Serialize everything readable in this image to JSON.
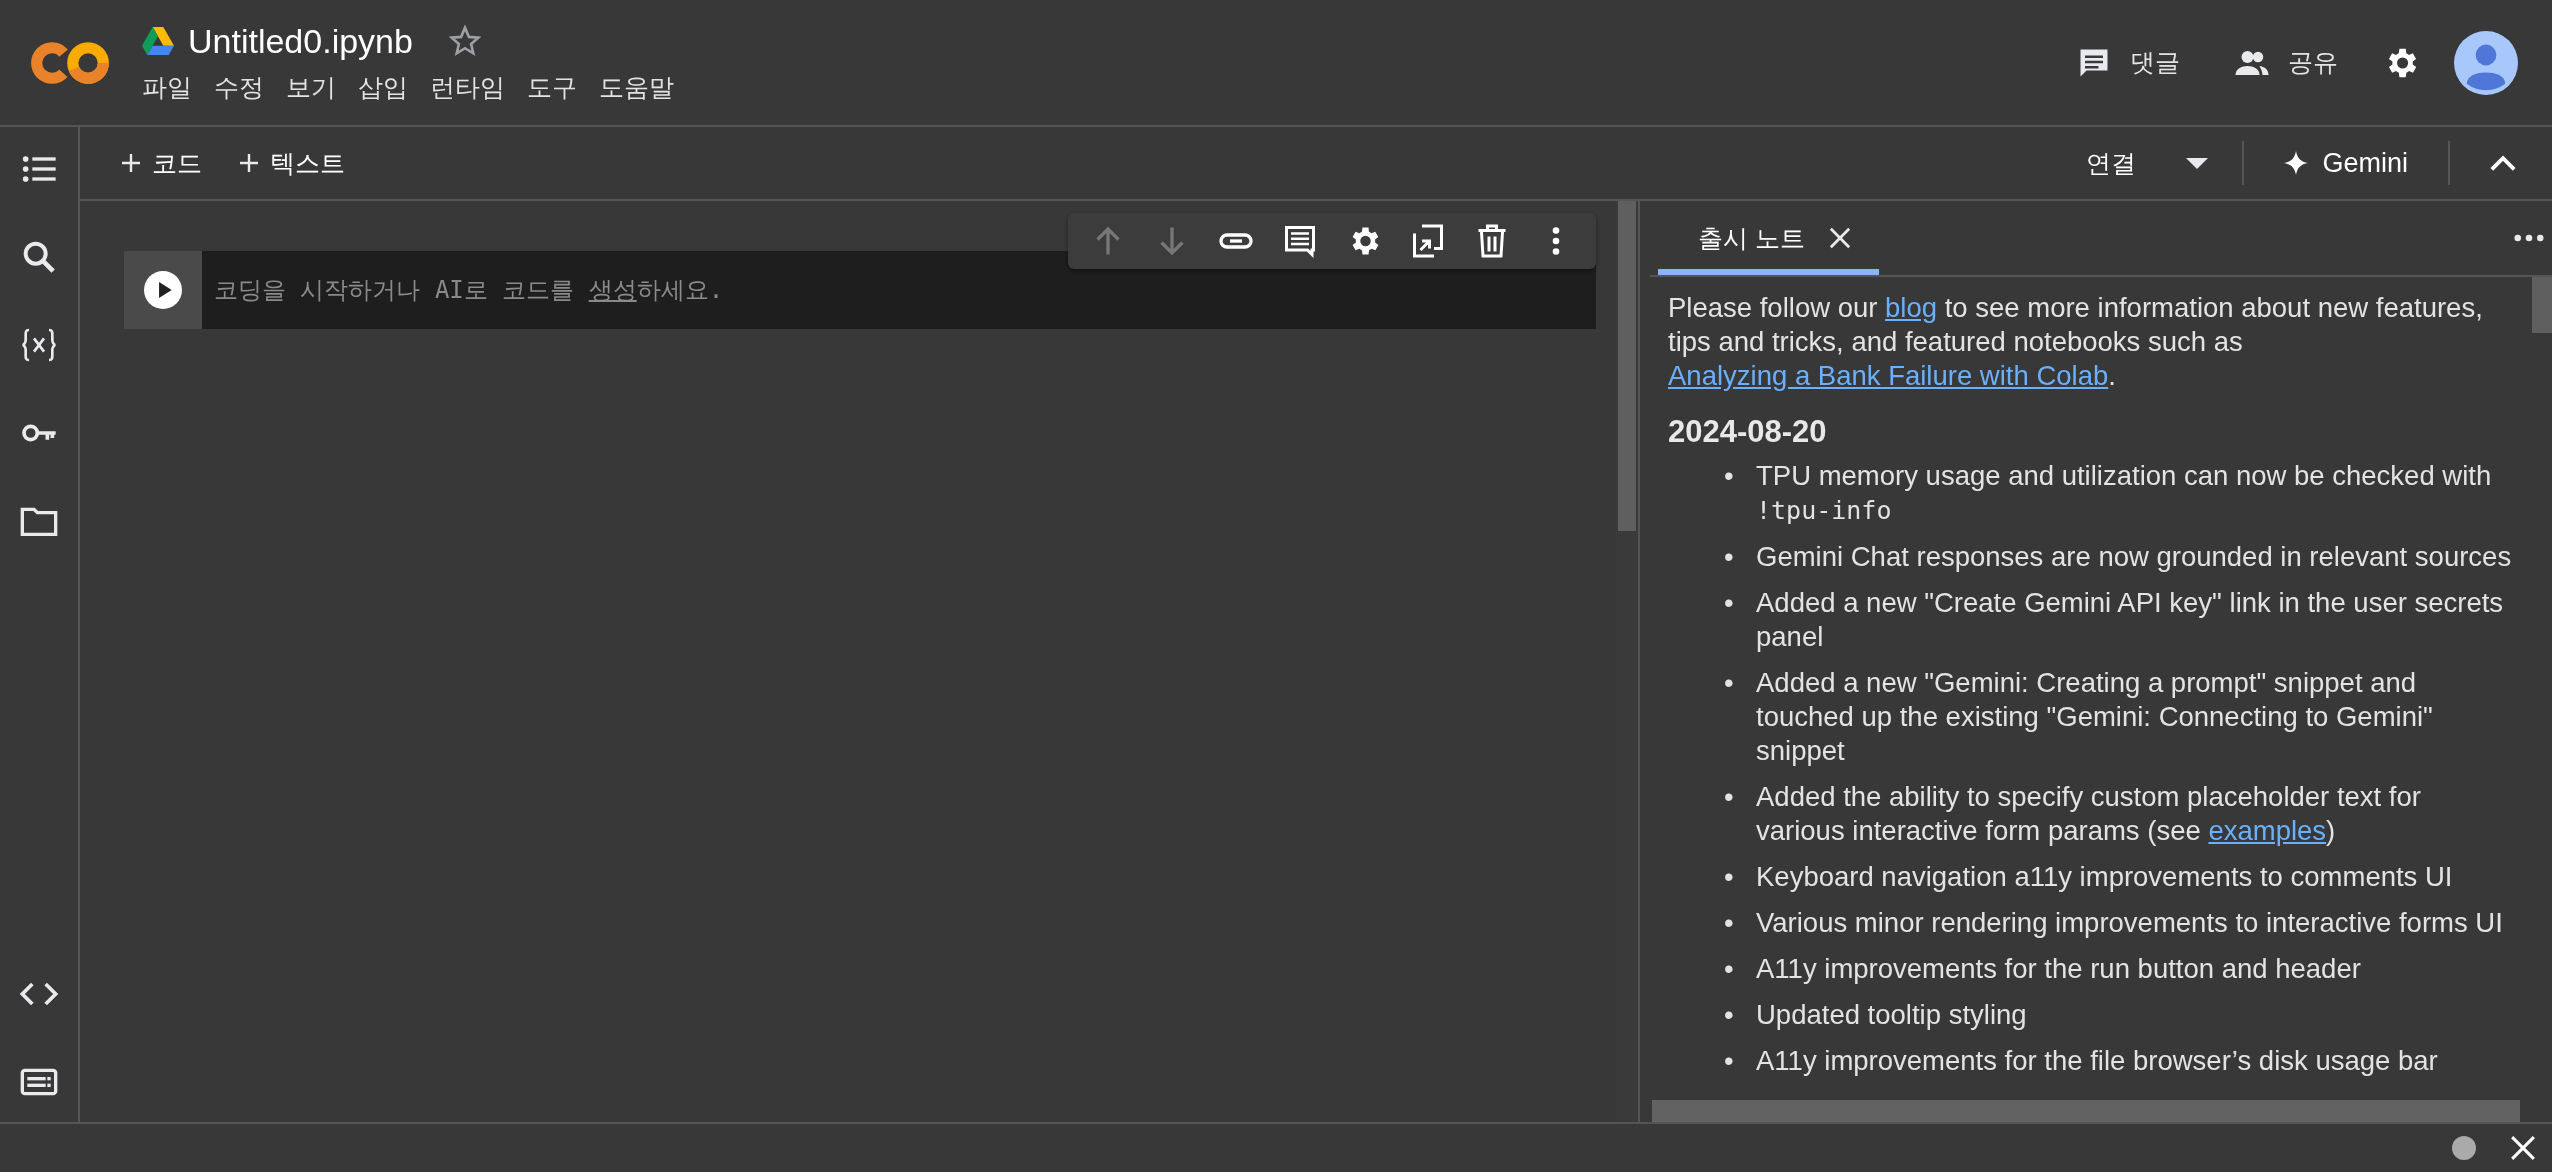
{
  "header": {
    "title": "Untitled0.ipynb",
    "starred": false,
    "menu": [
      "파일",
      "수정",
      "보기",
      "삽입",
      "런타임",
      "도구",
      "도움말"
    ],
    "actions": [
      {
        "kind": "comment",
        "label": "댓글"
      },
      {
        "kind": "share",
        "label": "공유"
      }
    ]
  },
  "toolbar": {
    "add": [
      "코드",
      "텍스트"
    ],
    "connect": "연결",
    "gemini": "Gemini"
  },
  "cell": {
    "hint": "코딩을 시작하거나 AI로 코드를 ",
    "hint_link": "생성",
    "hint_end": "하세요."
  },
  "notes": {
    "tab": "출시 노트",
    "intro": [
      {
        "kind": "text",
        "text": "Please follow our "
      },
      {
        "kind": "link",
        "text": "blog"
      },
      {
        "kind": "text",
        "text": " to see more information about new features, tips and tricks, and featured notebooks such as "
      },
      {
        "kind": "link",
        "text": "Analyzing a Bank Failure with Colab"
      },
      {
        "kind": "text",
        "text": "."
      }
    ],
    "date": "2024-08-20",
    "bullet": "•",
    "items": [
      [
        {
          "kind": "text",
          "text": "TPU memory usage and utilization can now be checked with "
        },
        {
          "kind": "code",
          "text": "!tpu-info"
        }
      ],
      [
        {
          "kind": "text",
          "text": "Gemini Chat responses are now grounded in relevant sources"
        }
      ],
      [
        {
          "kind": "text",
          "text": "Added a new \"Create Gemini API key\" link in the user secrets panel"
        }
      ],
      [
        {
          "kind": "text",
          "text": "Added a new \"Gemini: Creating a prompt\" snippet and touched up the existing \"Gemini: Connecting to Gemini\" snippet"
        }
      ],
      [
        {
          "kind": "text",
          "text": "Added the ability to specify custom placeholder text for various interactive form params (see "
        },
        {
          "kind": "link",
          "text": "examples"
        },
        {
          "kind": "text",
          "text": ")"
        }
      ],
      [
        {
          "kind": "text",
          "text": "Keyboard navigation a11y improvements to comments UI"
        }
      ],
      [
        {
          "kind": "text",
          "text": "Various minor rendering improvements to interactive forms UI"
        }
      ],
      [
        {
          "kind": "text",
          "text": "A11y improvements for the run button and header"
        }
      ],
      [
        {
          "kind": "text",
          "text": "Updated tooltip styling"
        }
      ],
      [
        {
          "kind": "text",
          "text": "A11y improvements for the file browser’s disk usage bar"
        }
      ]
    ]
  }
}
